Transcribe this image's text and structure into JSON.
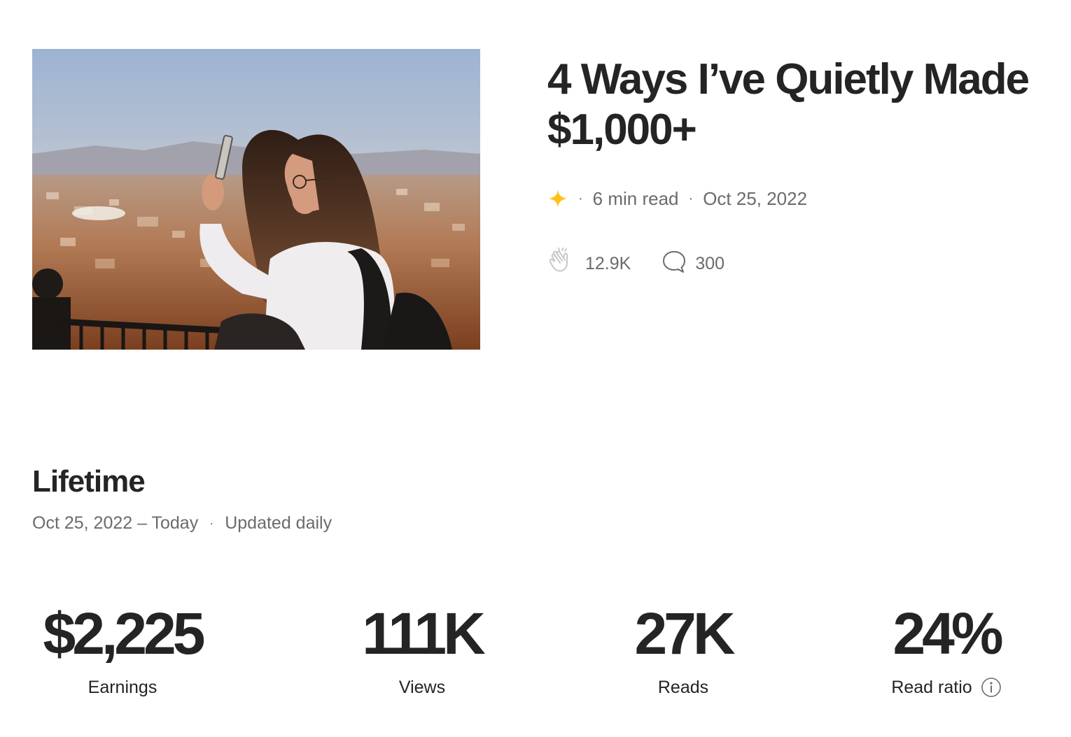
{
  "story": {
    "title": "4 Ways I’ve Quietly Made $1,000+",
    "read_time": "6 min read",
    "date": "Oct 25, 2022",
    "member_icon": "sparkle-star-icon",
    "claps": "12.9K",
    "responses": "300",
    "accent_color": "#ffc017"
  },
  "lifetime": {
    "title": "Lifetime",
    "range": "Oct 25, 2022 – Today",
    "update_note": "Updated daily"
  },
  "stats": [
    {
      "value": "$2,225",
      "label": "Earnings"
    },
    {
      "value": "111K",
      "label": "Views"
    },
    {
      "value": "27K",
      "label": "Reads"
    },
    {
      "value": "24%",
      "label": "Read ratio"
    }
  ]
}
